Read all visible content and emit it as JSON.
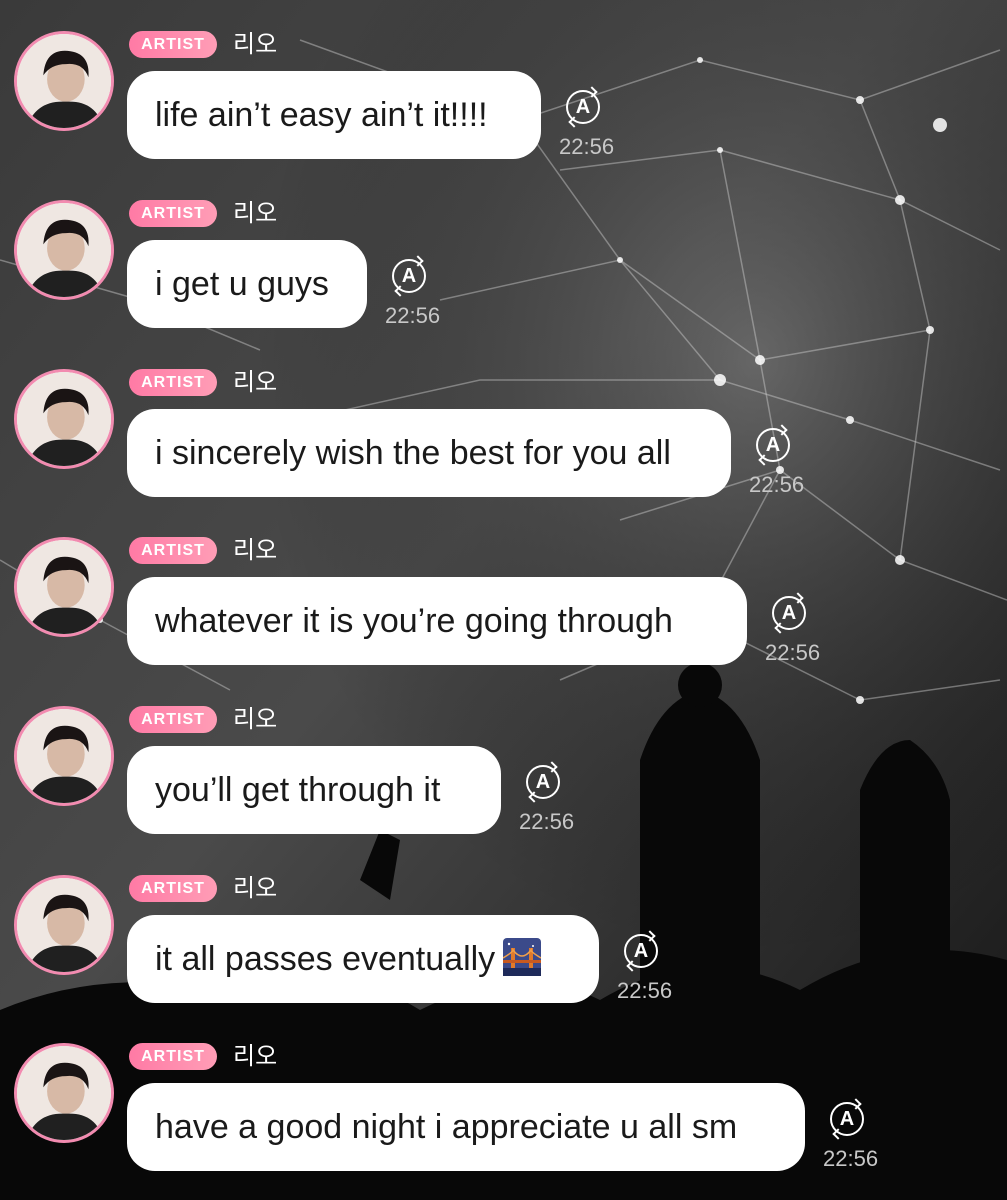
{
  "chat": {
    "messages": [
      {
        "badge": "ARTIST",
        "sender": "리오",
        "text": "life ain’t easy ain’t it!!!!",
        "time": "22:56",
        "emoji": ""
      },
      {
        "badge": "ARTIST",
        "sender": "리오",
        "text": "i get u guys",
        "time": "22:56",
        "emoji": ""
      },
      {
        "badge": "ARTIST",
        "sender": "리오",
        "text": "i sincerely wish the best for you all",
        "time": "22:56",
        "emoji": ""
      },
      {
        "badge": "ARTIST",
        "sender": "리오",
        "text": "whatever it is you’re going through",
        "time": "22:56",
        "emoji": ""
      },
      {
        "badge": "ARTIST",
        "sender": "리오",
        "text": "you’ll get through it",
        "time": "22:56",
        "emoji": ""
      },
      {
        "badge": "ARTIST",
        "sender": "리오",
        "text": "it all passes eventually",
        "time": "22:56",
        "emoji": "bridge-at-night"
      },
      {
        "badge": "ARTIST",
        "sender": "리오",
        "text": "have a good night i appreciate u all sm",
        "time": "22:56",
        "emoji": ""
      }
    ]
  },
  "icons": {
    "translate": "A",
    "avatar": "avatar-photo",
    "emoji": "bridge-at-night-emoji"
  },
  "colors": {
    "badge": "#ff7aa5",
    "avatar_ring": "#f28bb0",
    "bubble": "#ffffff",
    "time": "#c8c8c8"
  }
}
